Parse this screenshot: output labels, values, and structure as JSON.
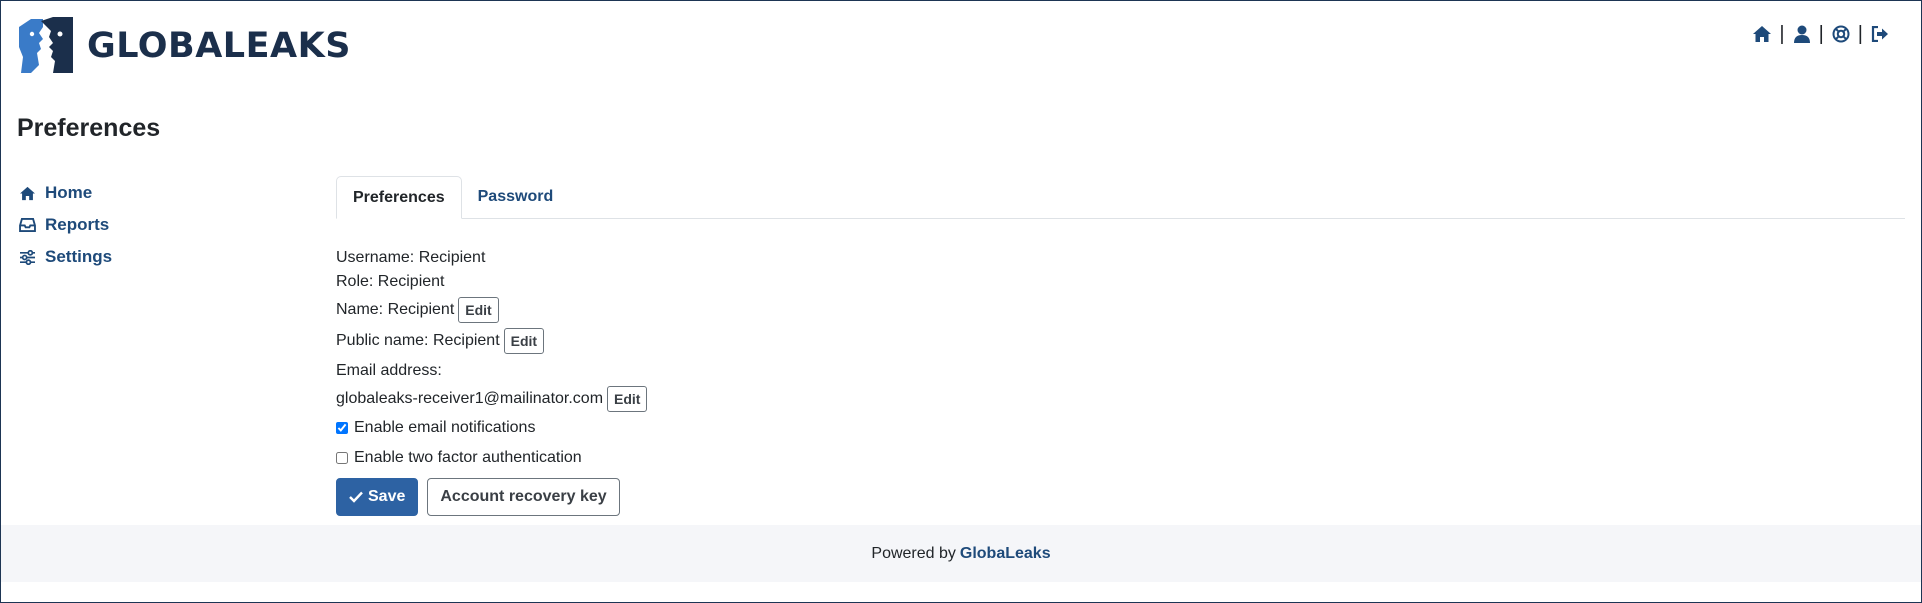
{
  "brand": {
    "name": "GLOBALEAKS",
    "logo_icon": "globaleaks-logo-icon"
  },
  "topnav": {
    "items": [
      {
        "icon": "home-icon"
      },
      {
        "icon": "user-icon"
      },
      {
        "icon": "lifebuoy-icon"
      },
      {
        "icon": "logout-icon"
      }
    ],
    "separator": "|"
  },
  "page": {
    "title": "Preferences"
  },
  "sidebar": {
    "items": [
      {
        "label": "Home",
        "icon": "home-icon"
      },
      {
        "label": "Reports",
        "icon": "inbox-icon"
      },
      {
        "label": "Settings",
        "icon": "sliders-icon"
      }
    ]
  },
  "tabs": [
    {
      "label": "Preferences",
      "active": true
    },
    {
      "label": "Password",
      "active": false
    }
  ],
  "profile": {
    "username": "Username: Recipient",
    "role": "Role: Recipient",
    "name": "Name: Recipient",
    "public_name": "Public name: Recipient",
    "email_label": "Email address:",
    "email_value": "globaleaks-receiver1@mailinator.com",
    "edit_label": "Edit"
  },
  "options": {
    "email_notifications": {
      "label": "Enable email notifications",
      "checked": true
    },
    "two_factor": {
      "label": "Enable two factor authentication",
      "checked": false
    }
  },
  "actions": {
    "save_label": "Save",
    "save_icon": "check-icon",
    "recovery_label": "Account recovery key"
  },
  "footer": {
    "prefix": "Powered by",
    "link": "GlobaLeaks"
  },
  "colors": {
    "primary": "#2d62a3",
    "link": "#1e4a7a",
    "brand_dark": "#1b2f4b",
    "footer_bg": "#f5f6f9"
  }
}
